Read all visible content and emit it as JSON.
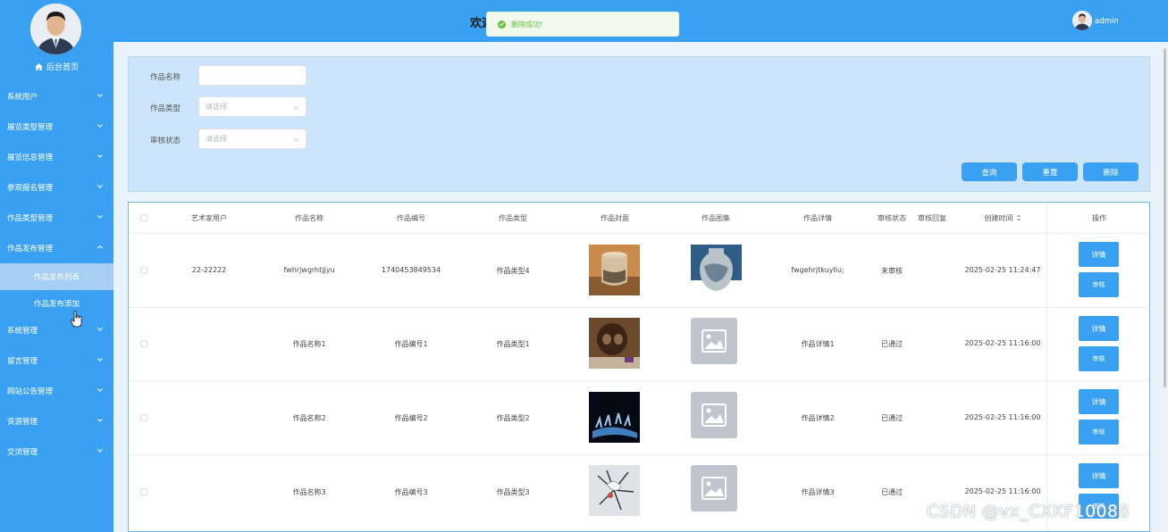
{
  "sidebar": {
    "home_label": "后台首页",
    "menu": [
      {
        "label": "系统用户"
      },
      {
        "label": "展览类型管理"
      },
      {
        "label": "展览信息管理"
      },
      {
        "label": "参观报名管理"
      },
      {
        "label": "作品类型管理"
      },
      {
        "label": "作品发布管理"
      },
      {
        "label": "系统管理"
      },
      {
        "label": "留言管理"
      },
      {
        "label": "网站公告管理"
      },
      {
        "label": "资源管理"
      },
      {
        "label": "交流管理"
      }
    ],
    "submenu": [
      {
        "label": "作品发布列表"
      },
      {
        "label": "作品发布添加"
      }
    ]
  },
  "header": {
    "title": "欢迎",
    "username": "admin"
  },
  "toast": {
    "message": "删除成功!"
  },
  "search": {
    "name_label": "作品名称",
    "name_value": "",
    "type_label": "作品类型",
    "type_placeholder": "请选择",
    "status_label": "审核状态",
    "status_placeholder": "请选择",
    "query_button": "查询",
    "reset_button": "重置",
    "delete_button": "删除"
  },
  "table": {
    "headers": {
      "artist": "艺术家用户",
      "name": "作品名称",
      "number": "作品编号",
      "type": "作品类型",
      "cover": "作品封面",
      "gallery": "作品图集",
      "detail": "作品详情",
      "status": "审核状态",
      "reply": "审核回复",
      "created": "创建时间",
      "sort_icon": "sort-icon",
      "action": "操作"
    },
    "detail_button": "详情",
    "review_button": "审核",
    "rows": [
      {
        "artist": "22-22222",
        "name": "fwhrjwgrhtjjyu",
        "number": "1740453849534",
        "type": "作品类型4",
        "detail": "fwgehrjtkuyliu;",
        "status": "未审核",
        "reply": "",
        "created": "2025-02-25 11:24:47",
        "cover": "vase-jar-image",
        "gallery": "blue-vase-image"
      },
      {
        "artist": "",
        "name": "作品名称1",
        "number": "作品编号1",
        "type": "作品类型1",
        "detail": "作品详情1",
        "status": "已通过",
        "reply": "",
        "created": "2025-02-25 11:16:00",
        "cover": "bronze-artifact-image",
        "gallery": "image-placeholder-icon"
      },
      {
        "artist": "",
        "name": "作品名称2",
        "number": "作品编号2",
        "type": "作品类型2",
        "detail": "作品详情2",
        "status": "已通过",
        "reply": "",
        "created": "2025-02-25 11:16:00",
        "cover": "dance-stage-image",
        "gallery": "image-placeholder-icon"
      },
      {
        "artist": "",
        "name": "作品名称3",
        "number": "作品编号3",
        "type": "作品类型3",
        "detail": "作品详情3",
        "status": "已通过",
        "reply": "",
        "created": "2025-02-25 11:16:00",
        "cover": "flower-sculpture-image",
        "gallery": "image-placeholder-icon"
      }
    ]
  },
  "watermark": "CSDN @vx_CXKF10088",
  "colors": {
    "primary": "#3aa1f2",
    "active_submenu": "#a7cff3",
    "search_panel": "#cde5fa",
    "toast_bg": "#f0f9eb",
    "toast_text": "#67c23a"
  }
}
